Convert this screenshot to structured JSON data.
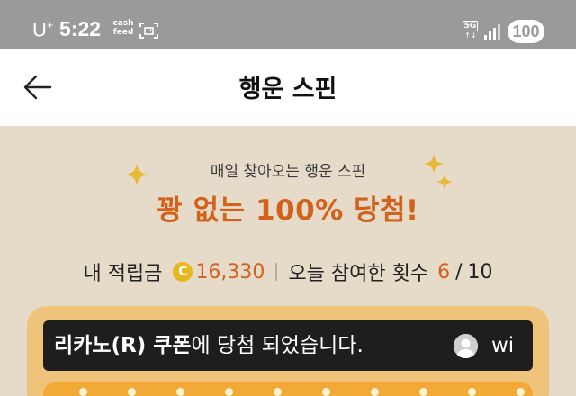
{
  "status_bar": {
    "carrier": "U",
    "carrier_plus": "+",
    "time": "5:22",
    "app_line1": "cash",
    "app_line2": "feed",
    "network": "5G",
    "network_arrows": "↑↓",
    "battery": "100"
  },
  "header": {
    "title": "행운 스핀"
  },
  "event": {
    "subtitle": "매일 찾아오는 행운 스핀",
    "headline": "꽝 없는 100% 당첨!",
    "points_label": "내 적립금",
    "coin_symbol": "C",
    "points_value": "16,330",
    "participation_label": "오늘 참여한 횟수",
    "participation_current": "6",
    "participation_separator": "/",
    "participation_max": "10"
  },
  "ticker": {
    "prize": "리카노(R) 쿠폰",
    "message": "에 당첨 되었습니다.",
    "next_partial": "wi"
  },
  "colors": {
    "accent": "#d2611c",
    "status_bar": "#9a9a9a",
    "background": "#e6dac8",
    "frame": "#f0c37a",
    "coin": "#e6b81c",
    "ticker_bg": "#1e1e1e"
  },
  "icons": {
    "back": "arrow-left-icon",
    "screenshot": "screenshot-icon",
    "signal": "signal-bars-icon",
    "sparkle": "sparkle-icon",
    "coin": "coin-icon",
    "avatar": "user-avatar-icon"
  }
}
